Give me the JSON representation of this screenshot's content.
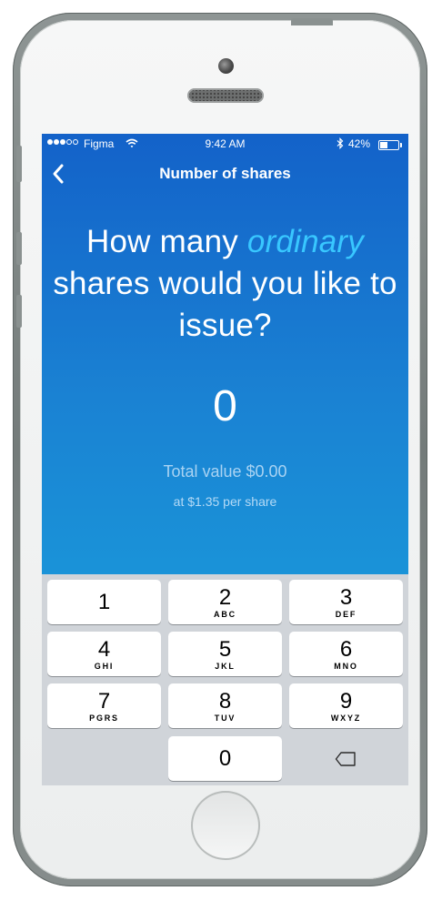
{
  "status_bar": {
    "carrier": "Figma",
    "time": "9:42 AM",
    "battery_percent": "42%",
    "battery_level": 0.42
  },
  "nav": {
    "title": "Number of shares"
  },
  "question": {
    "line_before": "How many",
    "emphasis": "ordinary",
    "line_after": "shares would you like to issue?"
  },
  "amount": "0",
  "total_value": "Total value $0.00",
  "per_share": "at $1.35 per share",
  "keypad": {
    "keys": [
      {
        "digit": "1",
        "letters": ""
      },
      {
        "digit": "2",
        "letters": "ABC"
      },
      {
        "digit": "3",
        "letters": "DEF"
      },
      {
        "digit": "4",
        "letters": "GHI"
      },
      {
        "digit": "5",
        "letters": "JKL"
      },
      {
        "digit": "6",
        "letters": "MNO"
      },
      {
        "digit": "7",
        "letters": "PGRS"
      },
      {
        "digit": "8",
        "letters": "TUV"
      },
      {
        "digit": "9",
        "letters": "WXYZ"
      },
      {
        "digit": "0",
        "letters": ""
      }
    ]
  },
  "colors": {
    "accent_text": "#38c7ff",
    "header_top": "#1362c9",
    "header_bottom": "#1a93d8",
    "keypad_bg": "#d0d4d9"
  },
  "icons": [
    "back-chevron-icon",
    "wifi-icon",
    "bluetooth-icon",
    "battery-icon",
    "delete-backspace-icon"
  ]
}
